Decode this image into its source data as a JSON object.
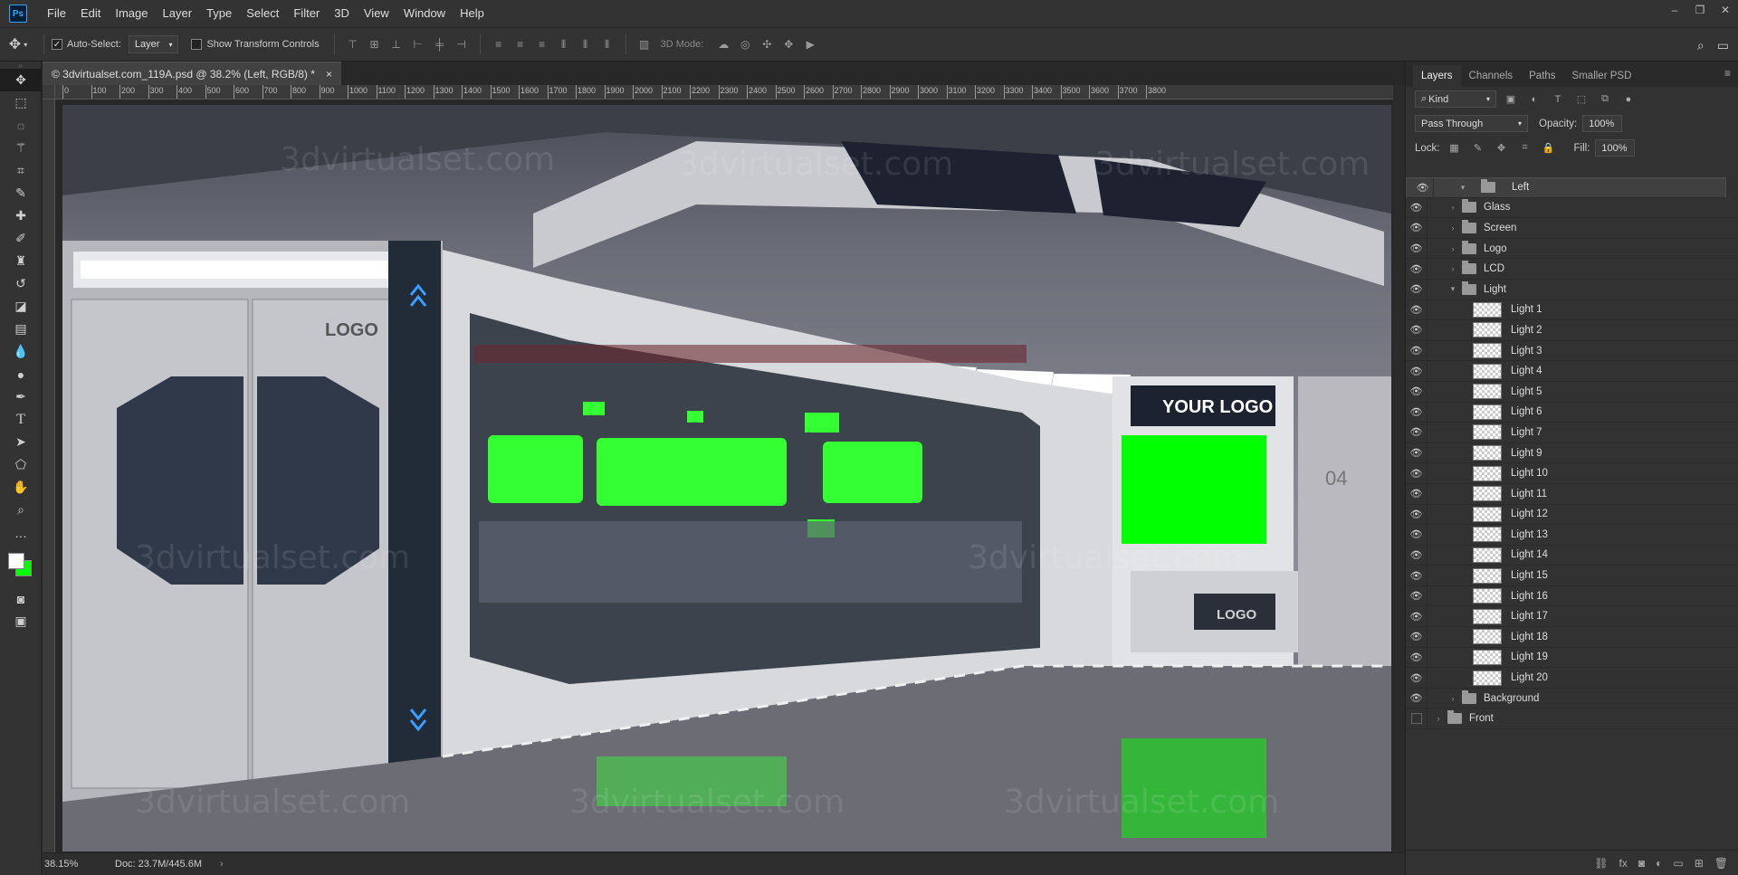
{
  "app": {
    "logo": "Ps"
  },
  "menu": [
    "File",
    "Edit",
    "Image",
    "Layer",
    "Type",
    "Select",
    "Filter",
    "3D",
    "View",
    "Window",
    "Help"
  ],
  "window_controls": [
    "–",
    "❐",
    "✕"
  ],
  "options": {
    "auto_select_label": "Auto-Select:",
    "auto_select_value": "Layer",
    "show_transform_label": "Show Transform Controls",
    "three_d_mode_label": "3D Mode:"
  },
  "document": {
    "tab_title": "© 3dvirtualset.com_119A.psd @ 38.2% (Left, RGB/8) *",
    "close": "×",
    "watermark": "3dvirtualset.com"
  },
  "ruler_top_labels": [
    "0",
    "100",
    "200",
    "300",
    "400",
    "500",
    "600",
    "700",
    "800",
    "900",
    "1000",
    "1100",
    "1200",
    "1300",
    "1400",
    "1500",
    "1600",
    "1700",
    "1800",
    "1900",
    "2000",
    "2100",
    "2200",
    "2300",
    "2400",
    "2500",
    "2600",
    "2700",
    "2800",
    "2900",
    "3000",
    "3100",
    "3200",
    "3300",
    "3400",
    "3500",
    "3600",
    "3700",
    "3800"
  ],
  "scene": {
    "logo_text": "YOUR LOGO",
    "door_logo": "LOGO",
    "desk_logo": "LOGO",
    "number_label": "04",
    "colors": {
      "greenscreen": "#33ff33",
      "accent": "#3aa0ff"
    }
  },
  "status": {
    "zoom": "38.15%",
    "doc": "Doc: 23.7M/445.6M",
    "arrow": "›"
  },
  "panel": {
    "tabs": [
      "Layers",
      "Channels",
      "Paths",
      "Smaller PSD"
    ],
    "menu_icon": "≡",
    "filter_kind": "Kind",
    "blend_mode": "Pass Through",
    "opacity_label": "Opacity:",
    "opacity_value": "100%",
    "lock_label": "Lock:",
    "fill_label": "Fill:",
    "fill_value": "100%"
  },
  "layers": [
    {
      "name": "Left",
      "type": "group",
      "expanded": true,
      "indent": 0,
      "visible": true,
      "selected": true
    },
    {
      "name": "Glass",
      "type": "group",
      "expanded": false,
      "indent": 1,
      "visible": true
    },
    {
      "name": "Screen",
      "type": "group",
      "expanded": false,
      "indent": 1,
      "visible": true
    },
    {
      "name": "Logo",
      "type": "group",
      "expanded": false,
      "indent": 1,
      "visible": true
    },
    {
      "name": "LCD",
      "type": "group",
      "expanded": false,
      "indent": 1,
      "visible": true
    },
    {
      "name": "Light",
      "type": "group",
      "expanded": true,
      "indent": 1,
      "visible": true
    },
    {
      "name": "Light 1",
      "type": "layer",
      "indent": 2,
      "visible": true
    },
    {
      "name": "Light 2",
      "type": "layer",
      "indent": 2,
      "visible": true
    },
    {
      "name": "Light 3",
      "type": "layer",
      "indent": 2,
      "visible": true
    },
    {
      "name": "Light 4",
      "type": "layer",
      "indent": 2,
      "visible": true
    },
    {
      "name": "Light 5",
      "type": "layer",
      "indent": 2,
      "visible": true
    },
    {
      "name": "Light 6",
      "type": "layer",
      "indent": 2,
      "visible": true
    },
    {
      "name": "Light 7",
      "type": "layer",
      "indent": 2,
      "visible": true
    },
    {
      "name": "Light 9",
      "type": "layer",
      "indent": 2,
      "visible": true
    },
    {
      "name": "Light 10",
      "type": "layer",
      "indent": 2,
      "visible": true
    },
    {
      "name": "Light 11",
      "type": "layer",
      "indent": 2,
      "visible": true
    },
    {
      "name": "Light 12",
      "type": "layer",
      "indent": 2,
      "visible": true
    },
    {
      "name": "Light 13",
      "type": "layer",
      "indent": 2,
      "visible": true
    },
    {
      "name": "Light 14",
      "type": "layer",
      "indent": 2,
      "visible": true
    },
    {
      "name": "Light 15",
      "type": "layer",
      "indent": 2,
      "visible": true
    },
    {
      "name": "Light 16",
      "type": "layer",
      "indent": 2,
      "visible": true
    },
    {
      "name": "Light 17",
      "type": "layer",
      "indent": 2,
      "visible": true
    },
    {
      "name": "Light 18",
      "type": "layer",
      "indent": 2,
      "visible": true
    },
    {
      "name": "Light 19",
      "type": "layer",
      "indent": 2,
      "visible": true
    },
    {
      "name": "Light 20",
      "type": "layer",
      "indent": 2,
      "visible": true
    },
    {
      "name": "Background",
      "type": "group",
      "expanded": false,
      "indent": 1,
      "visible": true
    },
    {
      "name": "Front",
      "type": "group",
      "expanded": false,
      "indent": 0,
      "visible": false
    }
  ]
}
